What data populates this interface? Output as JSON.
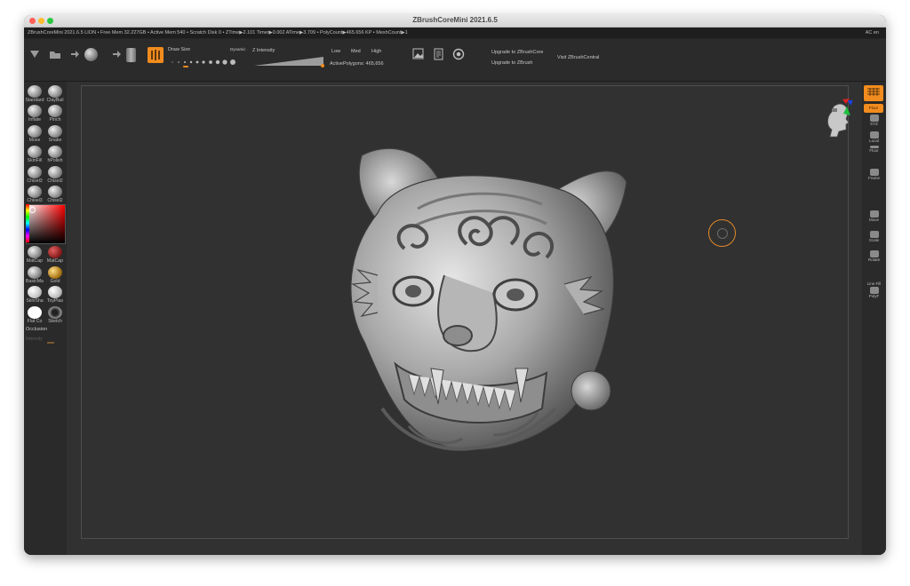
{
  "window": {
    "title": "ZBrushCoreMini 2021.6.5"
  },
  "infobar": {
    "left": "ZBrushCoreMini 2021.6.5 LION   • Free Mem 32.227GB • Active Mem 540 • Scratch Disk 0 •   ZTime▶2.101 Timer▶0.002 ATime▶3.709 • PolyCount▶465.656 KP • MeshCount▶1",
    "right": "AC     en"
  },
  "toolbar": {
    "draw_size_label": "Draw Size",
    "dynamic_label": "Dynamic",
    "z_intensity_label": "Z Intensity",
    "low_label": "Low",
    "med_label": "Med",
    "high_label": "High",
    "active_polygons": "ActivePolygons: 465,656",
    "upgrade_core": "Upgrade to ZBrushCore",
    "upgrade_zbrush": "Upgrade to ZBrush",
    "visit_central": "Visit ZBrushCentral"
  },
  "left_shelf": {
    "brushes": [
      {
        "label": "Standard"
      },
      {
        "label": "ClayBuil"
      },
      {
        "label": "Inflate"
      },
      {
        "label": "Pinch"
      },
      {
        "label": "Move"
      },
      {
        "label": "Snake"
      },
      {
        "label": "SkinFill"
      },
      {
        "label": "hPolish"
      },
      {
        "label": "Chisel3"
      },
      {
        "label": "Chisel2"
      },
      {
        "label": "Chisel3"
      },
      {
        "label": "Chisel2"
      }
    ],
    "materials": [
      {
        "label": "MatCap"
      },
      {
        "label": "MatCap"
      },
      {
        "label": "BasicMa"
      },
      {
        "label": "Gold"
      },
      {
        "label": "SkinSha"
      },
      {
        "label": "ToyPlas"
      },
      {
        "label": "Flat Co"
      },
      {
        "label": "Sketch"
      }
    ],
    "occlusion_label": "Occlusion",
    "intensity_label": "Intensity"
  },
  "right_shelf": {
    "buttons": [
      {
        "label": "Persp"
      },
      {
        "label": "Floor"
      },
      {
        "label": "XYZ"
      },
      {
        "label": "Local"
      },
      {
        "label": "Floor"
      },
      {
        "label": "Frame"
      },
      {
        "label": "Move"
      },
      {
        "label": "Scale"
      },
      {
        "label": "Rotate"
      },
      {
        "label": "Line Fill"
      },
      {
        "label": "PolyF"
      }
    ]
  },
  "colors": {
    "accent": "#f28c1e",
    "canvas": "#313131",
    "panel": "#2a2a2a"
  }
}
